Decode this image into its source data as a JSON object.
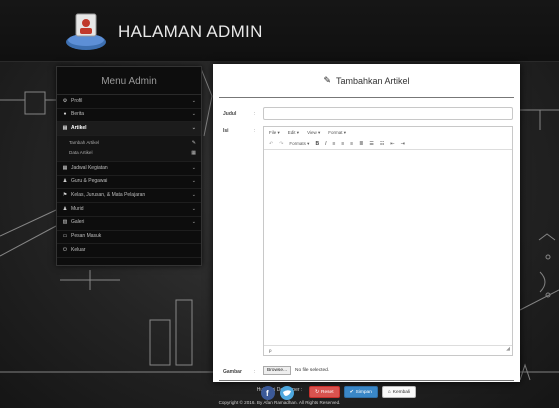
{
  "header": {
    "brand": "HALAMAN ADMIN"
  },
  "sidebar": {
    "title": "Menu Admin",
    "items": [
      {
        "label": "Profil",
        "icon": "gear-icon"
      },
      {
        "label": "Berita",
        "icon": "globe-icon"
      },
      {
        "label": "Artikel",
        "icon": "list-icon",
        "active": true,
        "subitems": [
          {
            "label": "Tambah Artikel",
            "icon": "pencil-icon"
          },
          {
            "label": "Data Artikel",
            "icon": "table-icon"
          }
        ]
      },
      {
        "label": "Jadwal Kegiatan",
        "icon": "calendar-icon"
      },
      {
        "label": "Guru & Pegawai",
        "icon": "user-icon"
      },
      {
        "label": "Kelas, Jurusan, & Mata Pelajaran",
        "icon": "flag-icon"
      },
      {
        "label": "Murid",
        "icon": "user-icon"
      },
      {
        "label": "Galeri",
        "icon": "image-icon"
      },
      {
        "label": "Pesan Masuk",
        "icon": "inbox-icon"
      },
      {
        "label": "Keluar",
        "icon": "power-icon"
      }
    ]
  },
  "panel": {
    "title": "Tambahkan Artikel",
    "judul_label": "Judul",
    "isi_label": "Isi",
    "gambar_label": "Gambar",
    "colon": ":",
    "judul_value": "",
    "editor": {
      "menus": [
        "File",
        "Edit",
        "View",
        "Format"
      ],
      "formats_label": "Formats",
      "status": "p"
    },
    "browse_label": "Browse...",
    "file_status": "No file selected.",
    "buttons": {
      "reset": "Reset",
      "save": "Simpan",
      "back": "Kembali"
    }
  },
  "footer": {
    "contact_title": "Hubungi Developer :",
    "copyright": "Copyright © 2016. By Afan Ramadhan. All Rights Reserved."
  },
  "colors": {
    "reset": "#d9534f",
    "save": "#3a87c7",
    "facebook": "#3b5998",
    "twitter": "#4da7de"
  }
}
